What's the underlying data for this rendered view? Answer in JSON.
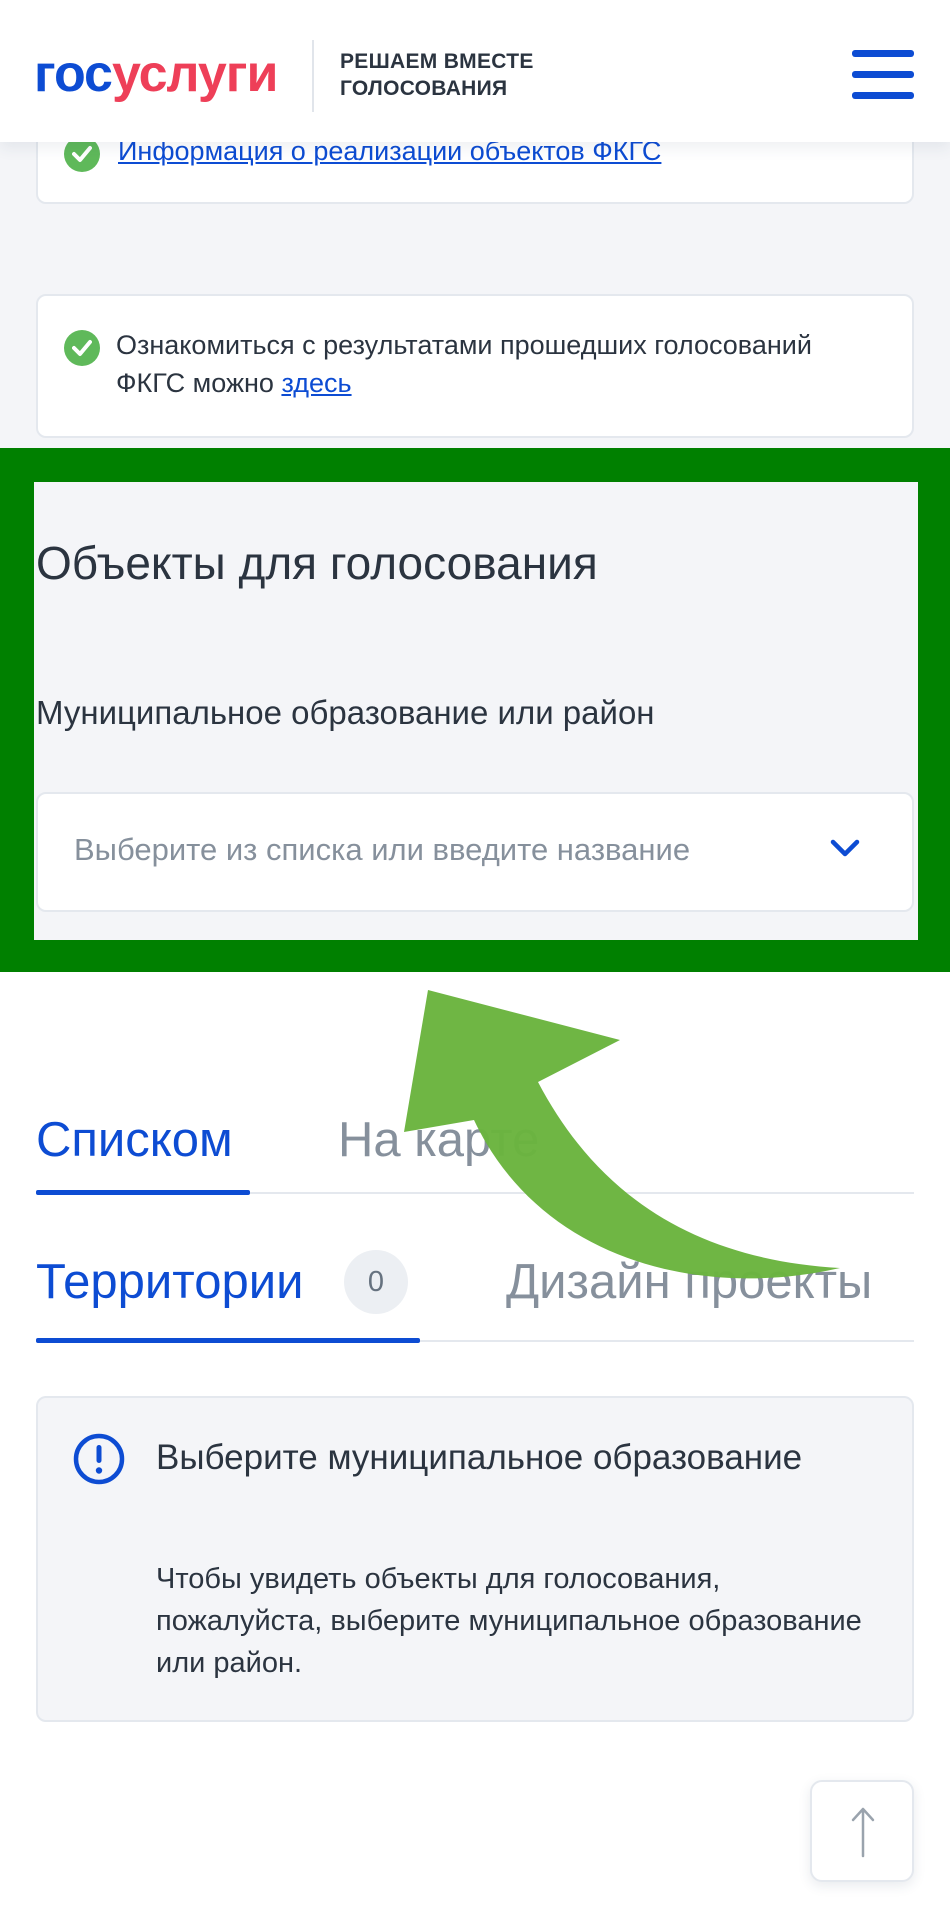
{
  "header": {
    "logo_part1": "гос",
    "logo_part2": "услуги",
    "tagline_line1": "РЕШАЕМ ВМЕСТЕ",
    "tagline_line2": "ГОЛОСОВАНИЯ",
    "menu_icon": "hamburger-menu-icon"
  },
  "info_cards": [
    {
      "icon": "check-circle-icon",
      "link_text": "Информация о реализации объектов ФКГС"
    },
    {
      "icon": "check-circle-icon",
      "text": "Ознакомиться с результатами прошедших голосований ФКГС можно ",
      "link_text": "здесь"
    }
  ],
  "voting_objects": {
    "title": "Объекты для голосования",
    "field_label": "Муниципальное образование или район",
    "select_placeholder": "Выберите из списка или введите название",
    "chevron_icon": "chevron-down-icon"
  },
  "view_tabs": [
    {
      "label": "Списком",
      "active": true
    },
    {
      "label": "На карте",
      "active": false
    }
  ],
  "category_tabs": [
    {
      "label": "Территории",
      "count": "0",
      "active": true
    },
    {
      "label": "Дизайн проекты",
      "active": false
    }
  ],
  "notice": {
    "icon": "exclamation-circle-icon",
    "title": "Выберите муниципальное образование",
    "body": "Чтобы увидеть объекты для голосования, пожалуйста, выберите муниципальное образование или район."
  },
  "scroll_top_icon": "arrow-up-icon",
  "colors": {
    "brand_blue": "#0d4cd3",
    "brand_red": "#ee3f58",
    "highlight_green": "#008000",
    "arrow_green": "#6ab43e",
    "check_green": "#5fb95a"
  }
}
